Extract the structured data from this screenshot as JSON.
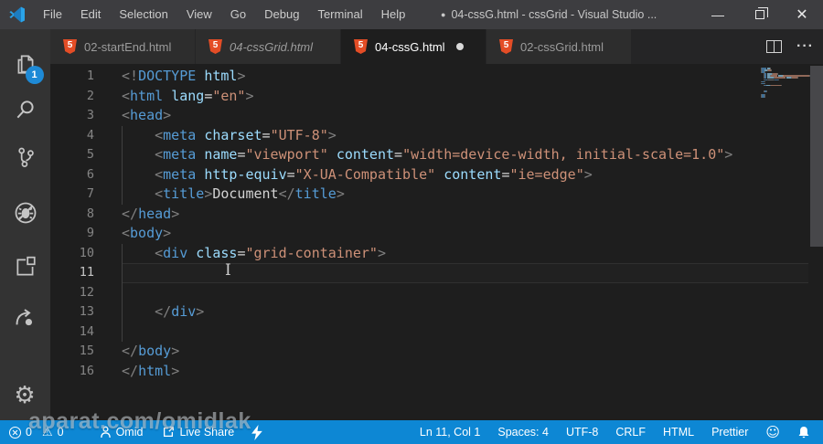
{
  "titlebar": {
    "menus": [
      "File",
      "Edit",
      "Selection",
      "View",
      "Go",
      "Debug",
      "Terminal",
      "Help"
    ],
    "dirty_dot": "●",
    "title": "04-cssG.html - cssGrid - Visual Studio ..."
  },
  "activitybar": {
    "icons": [
      "explorer",
      "search",
      "source-control",
      "debug",
      "extensions",
      "live-share",
      "settings"
    ],
    "explorer_badge": "1"
  },
  "tabbar": {
    "tabs": [
      {
        "label": "02-startEnd.html",
        "file_icon": "html5",
        "active": false,
        "preview": false,
        "dirty": false
      },
      {
        "label": "04-cssGrid.html",
        "file_icon": "html5",
        "active": false,
        "preview": true,
        "dirty": false
      },
      {
        "label": "04-cssG.html",
        "file_icon": "html5",
        "active": true,
        "preview": false,
        "dirty": true
      },
      {
        "label": "02-cssGrid.html",
        "file_icon": "html5",
        "active": false,
        "preview": false,
        "dirty": false
      }
    ],
    "actions": [
      "split-editor",
      "more-actions"
    ]
  },
  "editor": {
    "lines": [
      {
        "n": 1,
        "g": false,
        "cur": false,
        "t": [
          [
            "p",
            "<!"
          ],
          [
            "tag",
            "DOCTYPE"
          ],
          [
            "txt",
            " "
          ],
          [
            "attr",
            "html"
          ],
          [
            "p",
            ">"
          ]
        ]
      },
      {
        "n": 2,
        "g": false,
        "cur": false,
        "t": [
          [
            "p",
            "<"
          ],
          [
            "tag",
            "html"
          ],
          [
            "txt",
            " "
          ],
          [
            "attr",
            "lang"
          ],
          [
            "eq",
            "="
          ],
          [
            "str",
            "\"en\""
          ],
          [
            "p",
            ">"
          ]
        ]
      },
      {
        "n": 3,
        "g": false,
        "cur": false,
        "t": [
          [
            "p",
            "<"
          ],
          [
            "tag",
            "head"
          ],
          [
            "p",
            ">"
          ]
        ]
      },
      {
        "n": 4,
        "g": true,
        "cur": false,
        "t": [
          [
            "txt",
            "    "
          ],
          [
            "p",
            "<"
          ],
          [
            "tag",
            "meta"
          ],
          [
            "txt",
            " "
          ],
          [
            "attr",
            "charset"
          ],
          [
            "eq",
            "="
          ],
          [
            "str",
            "\"UTF-8\""
          ],
          [
            "p",
            ">"
          ]
        ]
      },
      {
        "n": 5,
        "g": true,
        "cur": false,
        "t": [
          [
            "txt",
            "    "
          ],
          [
            "p",
            "<"
          ],
          [
            "tag",
            "meta"
          ],
          [
            "txt",
            " "
          ],
          [
            "attr",
            "name"
          ],
          [
            "eq",
            "="
          ],
          [
            "str",
            "\"viewport\""
          ],
          [
            "txt",
            " "
          ],
          [
            "attr",
            "content"
          ],
          [
            "eq",
            "="
          ],
          [
            "str",
            "\"width=device-width, initial-scale=1.0\""
          ],
          [
            "p",
            ">"
          ]
        ]
      },
      {
        "n": 6,
        "g": true,
        "cur": false,
        "t": [
          [
            "txt",
            "    "
          ],
          [
            "p",
            "<"
          ],
          [
            "tag",
            "meta"
          ],
          [
            "txt",
            " "
          ],
          [
            "attr",
            "http-equiv"
          ],
          [
            "eq",
            "="
          ],
          [
            "str",
            "\"X-UA-Compatible\""
          ],
          [
            "txt",
            " "
          ],
          [
            "attr",
            "content"
          ],
          [
            "eq",
            "="
          ],
          [
            "str",
            "\"ie=edge\""
          ],
          [
            "p",
            ">"
          ]
        ]
      },
      {
        "n": 7,
        "g": true,
        "cur": false,
        "t": [
          [
            "txt",
            "    "
          ],
          [
            "p",
            "<"
          ],
          [
            "tag",
            "title"
          ],
          [
            "p",
            ">"
          ],
          [
            "txt",
            "Document"
          ],
          [
            "p",
            "</"
          ],
          [
            "tag",
            "title"
          ],
          [
            "p",
            ">"
          ]
        ]
      },
      {
        "n": 8,
        "g": false,
        "cur": false,
        "t": [
          [
            "p",
            "</"
          ],
          [
            "tag",
            "head"
          ],
          [
            "p",
            ">"
          ]
        ]
      },
      {
        "n": 9,
        "g": false,
        "cur": false,
        "t": [
          [
            "p",
            "<"
          ],
          [
            "tag",
            "body"
          ],
          [
            "p",
            ">"
          ]
        ]
      },
      {
        "n": 10,
        "g": true,
        "cur": false,
        "t": [
          [
            "txt",
            "    "
          ],
          [
            "p",
            "<"
          ],
          [
            "tag",
            "div"
          ],
          [
            "txt",
            " "
          ],
          [
            "attr",
            "class"
          ],
          [
            "eq",
            "="
          ],
          [
            "str",
            "\"grid-container\""
          ],
          [
            "p",
            ">"
          ]
        ]
      },
      {
        "n": 11,
        "g": true,
        "cur": true,
        "t": []
      },
      {
        "n": 12,
        "g": true,
        "cur": false,
        "t": []
      },
      {
        "n": 13,
        "g": true,
        "cur": false,
        "t": [
          [
            "txt",
            "    "
          ],
          [
            "p",
            "</"
          ],
          [
            "tag",
            "div"
          ],
          [
            "p",
            ">"
          ]
        ]
      },
      {
        "n": 14,
        "g": true,
        "cur": false,
        "t": []
      },
      {
        "n": 15,
        "g": false,
        "cur": false,
        "t": [
          [
            "p",
            "</"
          ],
          [
            "tag",
            "body"
          ],
          [
            "p",
            ">"
          ]
        ]
      },
      {
        "n": 16,
        "g": false,
        "cur": false,
        "t": [
          [
            "p",
            "</"
          ],
          [
            "tag",
            "html"
          ],
          [
            "p",
            ">"
          ]
        ]
      }
    ]
  },
  "statusbar": {
    "errors": "0",
    "warnings": "0",
    "account": "Omid",
    "live_share": "Live Share",
    "line_col": "Ln 11, Col 1",
    "indentation": "Spaces: 4",
    "encoding": "UTF-8",
    "eol": "CRLF",
    "language": "HTML",
    "formatter": "Prettier",
    "icons": [
      "errors",
      "warnings",
      "account",
      "live-share",
      "flash",
      "smiley",
      "bell"
    ]
  },
  "watermark": "aparat.com/omidlak",
  "colors": {
    "statusbar_accent": "#0d87d4",
    "badge_blue": "#1e8ad6",
    "html5_orange": "#e44d26",
    "syntax_tag": "#569cd6",
    "syntax_attribute": "#9cdcfe",
    "syntax_string": "#ce9178",
    "syntax_punctuation": "#808080",
    "syntax_text": "#d4d4d4",
    "editor_bg": "#1e1e1e",
    "activitybar_bg": "#333333",
    "tabbar_bg": "#252526"
  }
}
